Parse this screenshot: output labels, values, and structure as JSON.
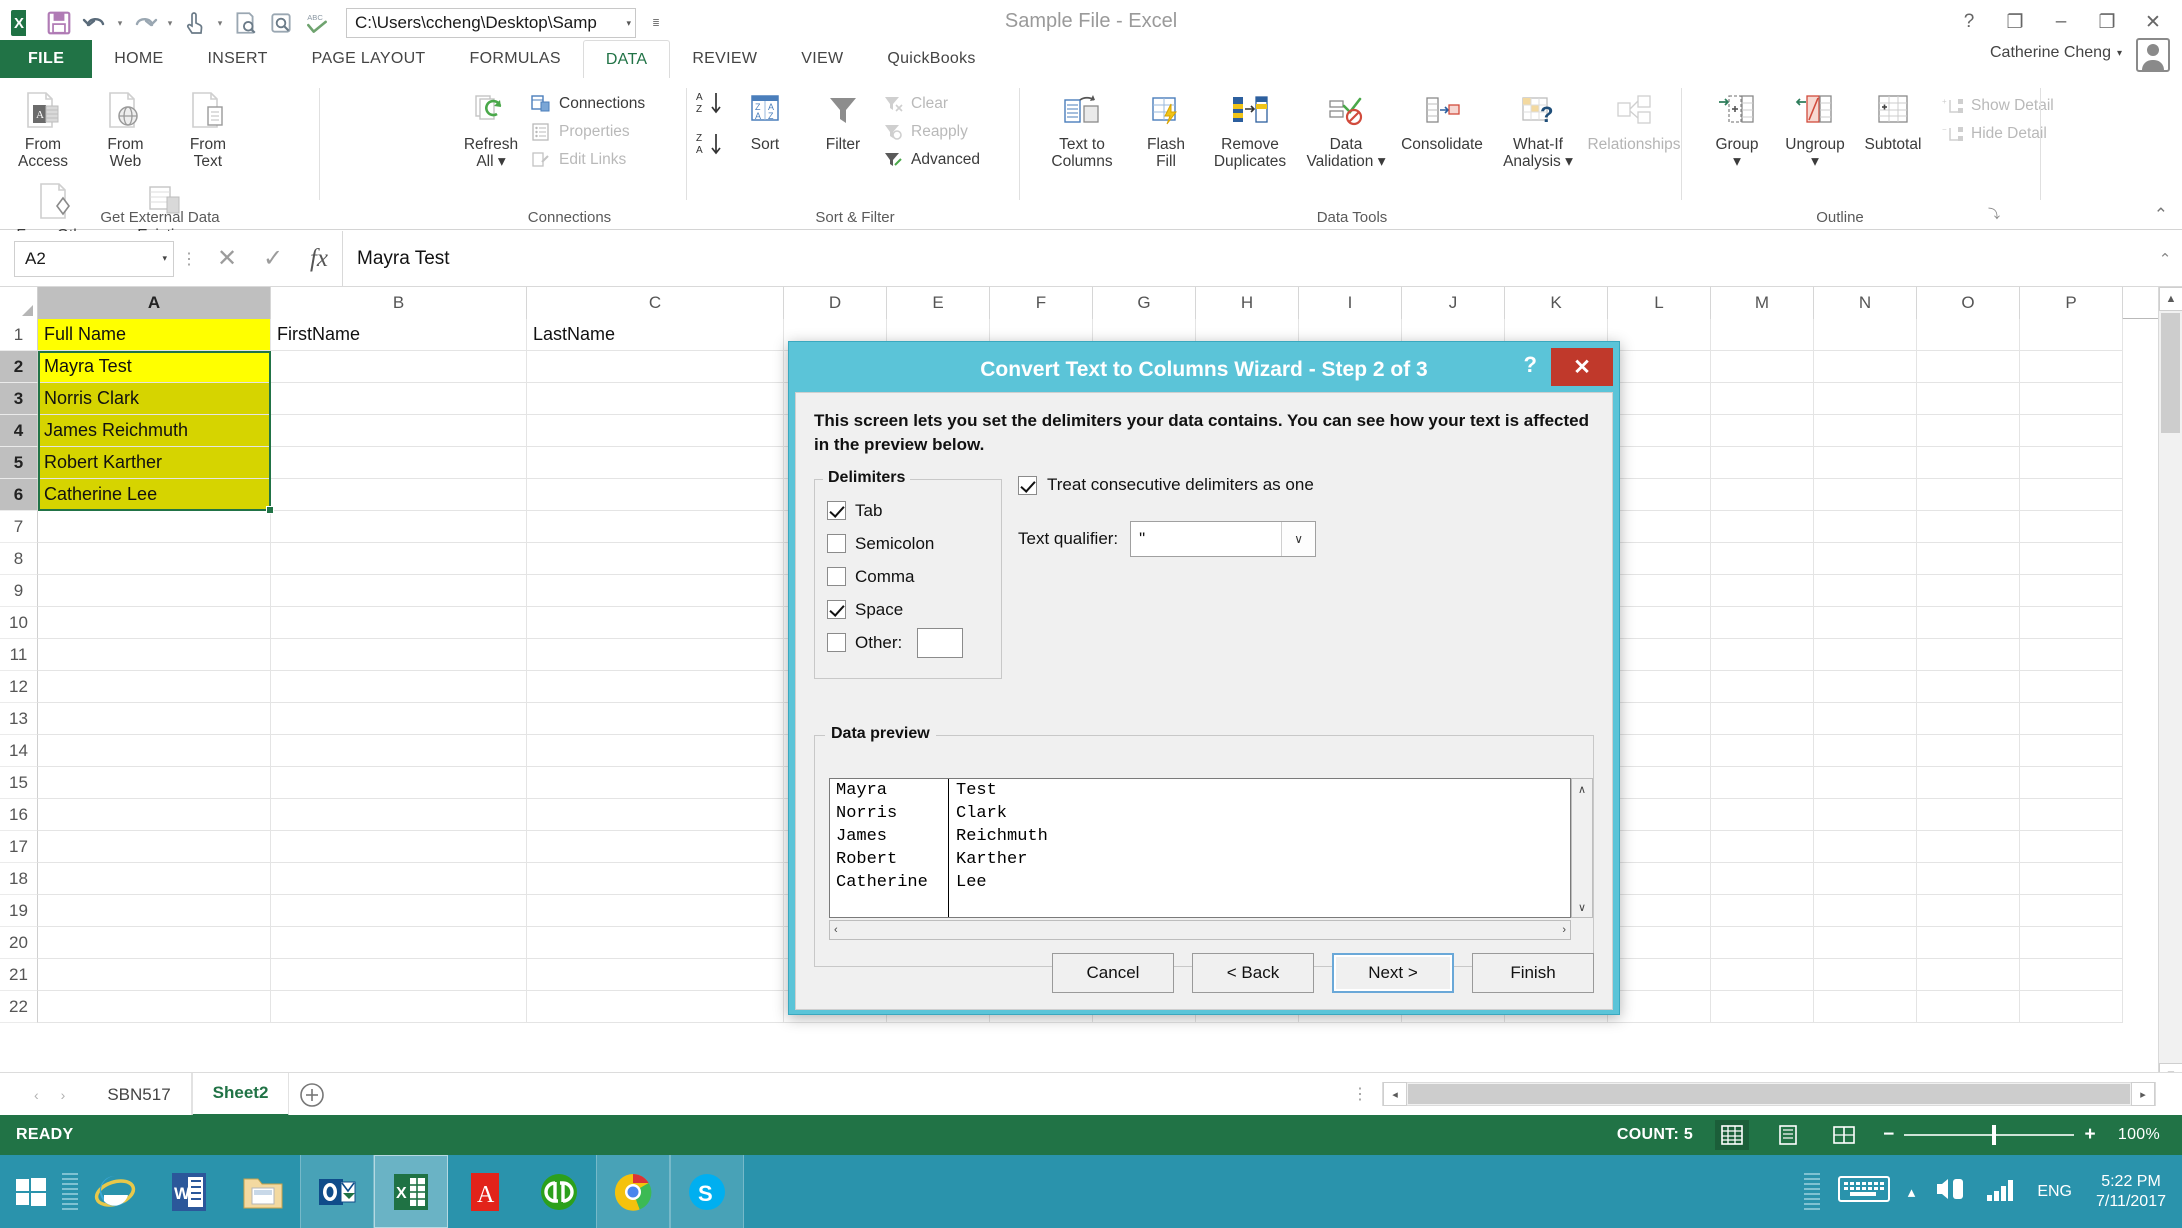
{
  "titlebar": {
    "quick_access": [
      {
        "name": "excel-logo-icon",
        "label": "X"
      },
      {
        "name": "save-icon",
        "label": "Save"
      },
      {
        "name": "undo-icon",
        "label": "Undo"
      },
      {
        "name": "redo-icon",
        "label": "Redo"
      },
      {
        "name": "touch-mode-icon",
        "label": "Touch/Mouse Mode"
      },
      {
        "name": "print-preview-icon",
        "label": "Print Preview"
      },
      {
        "name": "quick-print-icon",
        "label": "Quick Print"
      },
      {
        "name": "spelling-icon",
        "label": "Spelling"
      }
    ],
    "path_value": "C:\\Users\\ccheng\\Desktop\\Samp",
    "path_dropdown": "▾",
    "customize_qat": "≣",
    "window_title": "Sample File - Excel",
    "help_btn": "?",
    "ribbon_display_btn": "❐",
    "minimize_btn": "–",
    "restore_btn": "❐",
    "close_btn": "✕"
  },
  "tabs": {
    "file": "FILE",
    "items": [
      {
        "label": "HOME",
        "active": false
      },
      {
        "label": "INSERT",
        "active": false
      },
      {
        "label": "PAGE LAYOUT",
        "active": false
      },
      {
        "label": "FORMULAS",
        "active": false
      },
      {
        "label": "DATA",
        "active": true
      },
      {
        "label": "REVIEW",
        "active": false
      },
      {
        "label": "VIEW",
        "active": false
      },
      {
        "label": "QuickBooks",
        "active": false
      }
    ],
    "account_name": "Catherine Cheng",
    "account_caret": "▾"
  },
  "ribbon": {
    "groups": [
      {
        "name": "get-external-data",
        "label": "Get External Data"
      },
      {
        "name": "connections",
        "label": "Connections"
      },
      {
        "name": "sort-and-filter",
        "label": "Sort & Filter"
      },
      {
        "name": "data-tools",
        "label": "Data Tools"
      },
      {
        "name": "outline",
        "label": "Outline"
      }
    ],
    "get_external_data": [
      {
        "name": "from-access-button",
        "label": "From\nAccess"
      },
      {
        "name": "from-web-button",
        "label": "From\nWeb"
      },
      {
        "name": "from-text-button",
        "label": "From\nText"
      },
      {
        "name": "from-other-sources-button",
        "label": "From Other\nSources ▾"
      }
    ],
    "existing_connections": {
      "name": "existing-connections-button",
      "label": "Existing\nConnections"
    },
    "refresh_all": {
      "name": "refresh-all-button",
      "label": "Refresh\nAll ▾"
    },
    "connections_items": [
      {
        "name": "connections-button",
        "label": "Connections",
        "dim": false
      },
      {
        "name": "properties-button",
        "label": "Properties",
        "dim": true
      },
      {
        "name": "edit-links-button",
        "label": "Edit Links",
        "dim": true
      }
    ],
    "sort_filter": {
      "sort_az": "A↓",
      "sort_za": "Z↑",
      "sort_button": "Sort",
      "filter_button": "Filter",
      "clear": "Clear",
      "reapply": "Reapply",
      "advanced": "Advanced"
    },
    "data_tools": [
      {
        "name": "text-to-columns-button",
        "label": "Text to\nColumns"
      },
      {
        "name": "flash-fill-button",
        "label": "Flash\nFill"
      },
      {
        "name": "remove-duplicates-button",
        "label": "Remove\nDuplicates"
      },
      {
        "name": "data-validation-button",
        "label": "Data\nValidation ▾"
      },
      {
        "name": "consolidate-button",
        "label": "Consolidate"
      },
      {
        "name": "what-if-analysis-button",
        "label": "What-If\nAnalysis ▾"
      },
      {
        "name": "relationships-button",
        "label": "Relationships"
      }
    ],
    "outline": [
      {
        "name": "group-button",
        "label": "Group\n▾"
      },
      {
        "name": "ungroup-button",
        "label": "Ungroup\n▾"
      },
      {
        "name": "subtotal-button",
        "label": "Subtotal"
      }
    ],
    "outline_small": [
      {
        "name": "show-detail-button",
        "label": "Show Detail"
      },
      {
        "name": "hide-detail-button",
        "label": "Hide Detail"
      }
    ],
    "dialog_launcher": "⤵",
    "collapse_ribbon": "⌃"
  },
  "formula_bar": {
    "name_box": "A2",
    "name_box_caret": "▾",
    "cancel_icon": "✕",
    "enter_icon": "✓",
    "fx_label": "fx",
    "value": "Mayra Test",
    "expand_caret": "⌃"
  },
  "grid": {
    "columns": [
      "A",
      "B",
      "C",
      "D",
      "E",
      "F",
      "G",
      "H",
      "I",
      "J",
      "K",
      "L",
      "M",
      "N",
      "O",
      "P"
    ],
    "selected_column": "A",
    "rows": [
      "1",
      "2",
      "3",
      "4",
      "5",
      "6",
      "7",
      "8",
      "9",
      "10",
      "11",
      "12",
      "13",
      "14",
      "15",
      "16",
      "17",
      "18",
      "19",
      "20",
      "21",
      "22"
    ],
    "selected_rows": [
      "2",
      "3",
      "4",
      "5",
      "6"
    ],
    "cells": {
      "A1": "Full Name",
      "B1": "FirstName",
      "C1": "LastName",
      "A2": "Mayra Test",
      "A3": "Norris Clark",
      "A4": "James Reichmuth",
      "A5": "Robert Karther",
      "A6": "Catherine Lee"
    },
    "highlight_color": "#ffff00",
    "selection_color": "#d6d400",
    "selection_border_color": "#217346"
  },
  "sheet_bar": {
    "prev_icon": "‹",
    "next_icon": "›",
    "tabs": [
      {
        "label": "SBN517",
        "active": false
      },
      {
        "label": "Sheet2",
        "active": true
      }
    ],
    "add_sheet_icon": "⊕",
    "grip_dots": "⋮",
    "scroll_left": "◂",
    "scroll_right": "▸"
  },
  "status_bar": {
    "mode": "READY",
    "count_label": "COUNT: 5",
    "view_normal": "normal-view-icon",
    "view_page_layout": "page-layout-view-icon",
    "view_page_break": "page-break-view-icon",
    "zoom_out": "−",
    "zoom_in": "+",
    "zoom_level": "100%"
  },
  "dialog": {
    "title": "Convert Text to Columns Wizard - Step 2 of 3",
    "help_button": "?",
    "close_button": "✕",
    "intro_text": "This screen lets you set the delimiters your data contains.  You can see how your text is affected in the preview below.",
    "delimiters_legend": "Delimiters",
    "delimiters": [
      {
        "name": "tab-checkbox",
        "label": "Tab",
        "underline": "T",
        "checked": true
      },
      {
        "name": "semicolon-checkbox",
        "label": "Semicolon",
        "underline": "m",
        "checked": false
      },
      {
        "name": "comma-checkbox",
        "label": "Comma",
        "underline": "C",
        "checked": false
      },
      {
        "name": "space-checkbox",
        "label": "Space",
        "underline": "S",
        "checked": true
      },
      {
        "name": "other-checkbox",
        "label": "Other:",
        "underline": "O",
        "checked": false
      }
    ],
    "other_value": "",
    "treat_consecutive": {
      "label": "Treat consecutive delimiters as one",
      "checked": true
    },
    "text_qualifier_label": "Text qualifier:",
    "text_qualifier_value": "\"",
    "text_qualifier_caret": "∨",
    "preview_legend": "Data preview",
    "preview_rows": [
      {
        "first": "Mayra",
        "last": "Test"
      },
      {
        "first": "Norris",
        "last": "Clark"
      },
      {
        "first": "James",
        "last": "Reichmuth"
      },
      {
        "first": "Robert",
        "last": "Karther"
      },
      {
        "first": "Catherine",
        "last": "Lee"
      }
    ],
    "preview_scroll_up": "∧",
    "preview_scroll_down": "∨",
    "preview_scroll_left": "‹",
    "preview_scroll_right": "›",
    "buttons": [
      {
        "name": "cancel-button",
        "label": "Cancel",
        "default": false
      },
      {
        "name": "back-button",
        "label": "< Back",
        "default": false
      },
      {
        "name": "next-button",
        "label": "Next >",
        "default": true
      },
      {
        "name": "finish-button",
        "label": "Finish",
        "default": false
      }
    ]
  },
  "taskbar": {
    "start": "start-button",
    "items": [
      {
        "name": "internet-explorer-taskbar-icon",
        "label": "Internet Explorer",
        "state": ""
      },
      {
        "name": "word-taskbar-icon",
        "label": "Word",
        "state": ""
      },
      {
        "name": "file-explorer-taskbar-icon",
        "label": "File Explorer",
        "state": ""
      },
      {
        "name": "outlook-taskbar-icon",
        "label": "Outlook",
        "state": "open"
      },
      {
        "name": "excel-taskbar-icon",
        "label": "Excel",
        "state": "active"
      },
      {
        "name": "adobe-reader-taskbar-icon",
        "label": "Adobe Reader",
        "state": ""
      },
      {
        "name": "quickbooks-taskbar-icon",
        "label": "QuickBooks",
        "state": ""
      },
      {
        "name": "chrome-taskbar-icon",
        "label": "Google Chrome",
        "state": "open"
      },
      {
        "name": "skype-taskbar-icon",
        "label": "Skype",
        "state": "open"
      }
    ],
    "tray": {
      "keyboard_icon": "keyboard-icon",
      "show_hidden": "▴",
      "volume_icon": "volume-icon",
      "network_icon": "network-icon",
      "language": "ENG",
      "time": "5:22 PM",
      "date": "7/11/2017"
    }
  }
}
